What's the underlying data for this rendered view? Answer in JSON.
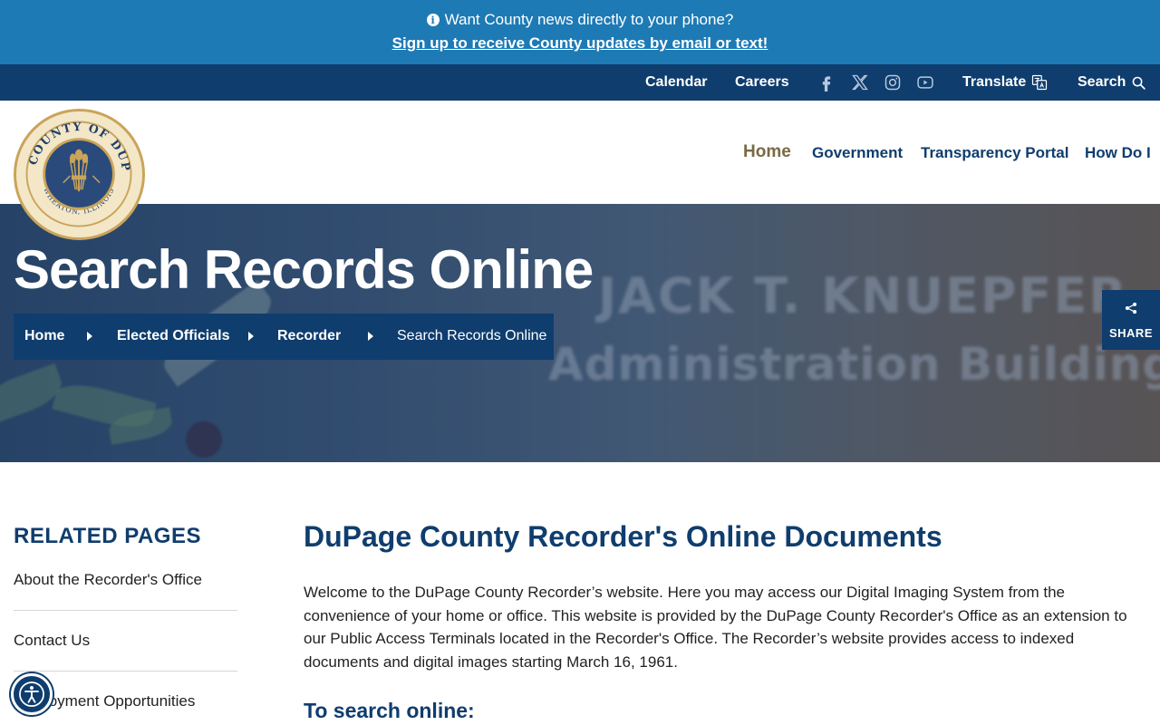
{
  "alert": {
    "message": "Want County news directly to your phone?",
    "link_text": "Sign up to receive County updates by email or text!",
    "icon": "info-icon"
  },
  "utility": {
    "calendar": "Calendar",
    "careers": "Careers",
    "social": [
      "facebook-icon",
      "x-twitter-icon",
      "instagram-icon",
      "youtube-icon"
    ],
    "translate": "Translate",
    "search": "Search"
  },
  "logo": {
    "alt": "THE COUNTY OF DUPAGE - WHEATON, ILLINOIS"
  },
  "nav": {
    "items": [
      "Home",
      "Government",
      "Transparency Portal",
      "How Do I"
    ],
    "active": "Home"
  },
  "hero": {
    "title": "Search Records Online",
    "background_line1": "JACK T. KNUEPFER",
    "background_line2": "Administration Building",
    "breadcrumb": [
      "Home",
      "Elected Officials",
      "Recorder",
      "Search Records Online"
    ]
  },
  "share": {
    "label": "SHARE"
  },
  "sidebar": {
    "title": "RELATED PAGES",
    "items": [
      "About the Recorder's Office",
      "Contact Us",
      "Employment Opportunities"
    ]
  },
  "main": {
    "title": "DuPage County Recorder's Online Documents",
    "paragraph": "Welcome to the DuPage County Recorder’s website. Here you may access our Digital Imaging System from the convenience of your home or office. This website is provided by the DuPage County Recorder's Office as an extension to our Public Access Terminals located in the Recorder's Office. The Recorder’s website provides access to indexed documents and digital images starting March 16, 1961.",
    "subtitle": "To search online:"
  },
  "colors": {
    "alert_bg": "#1d7ab5",
    "navy": "#0f3d6e",
    "active_nav": "#7a6a44",
    "gold": "#c9a45a"
  }
}
